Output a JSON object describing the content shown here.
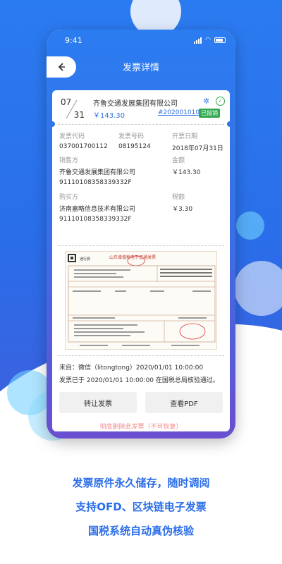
{
  "status_bar": {
    "time": "9:41"
  },
  "navbar": {
    "title": "发票详情",
    "back_icon": "chevron-left-icon"
  },
  "invoice": {
    "date_month": "07",
    "date_day": "31",
    "company": "齐鲁交通发展集团有限公司",
    "amount": "￥143.30",
    "number_link": "#20200101001",
    "status_badge": "已报销",
    "icons": [
      "blockchain-icon",
      "verified-icon"
    ]
  },
  "fields": {
    "invoice_code_label": "发票代码",
    "invoice_code": "037001700112",
    "invoice_number_label": "发票号码",
    "invoice_number": "08195124",
    "issue_date_label": "开票日期",
    "issue_date": "2018年07月31日",
    "seller_label": "销售方",
    "seller_name": "齐鲁交通发展集团有限公司",
    "seller_tax_id": "91110108358339332F",
    "amount_label": "金额",
    "amount_value": "￥143.30",
    "buyer_label": "购买方",
    "buyer_name": "济南嘉略信息技术有限公司",
    "buyer_tax_id": "91110108358339332F",
    "tax_label": "税额",
    "tax_value": "￥3.30"
  },
  "invoice_image": {
    "header_title": "山东增值税电子普通发票",
    "tag": "通行费"
  },
  "source": {
    "from_line": "来自：微信（litongtong）2020/01/01 10:00:00",
    "verify_line": "发票已于 2020/01/01 10:00:00 在国税总局核验通过。"
  },
  "actions": {
    "transfer": "转让发票",
    "view_pdf": "查看PDF",
    "delete": "彻底删除此发票（不可恢复）"
  },
  "taglines": [
    "发票原件永久储存，随时调阅",
    "支持OFD、区块链电子发票",
    "国税系统自动真伪核验"
  ],
  "colors": {
    "brand_blue": "#2b7bf0",
    "accent_blue": "#2e6fe0",
    "badge_green": "#2fa84f",
    "danger_pink": "#f08a8a"
  }
}
